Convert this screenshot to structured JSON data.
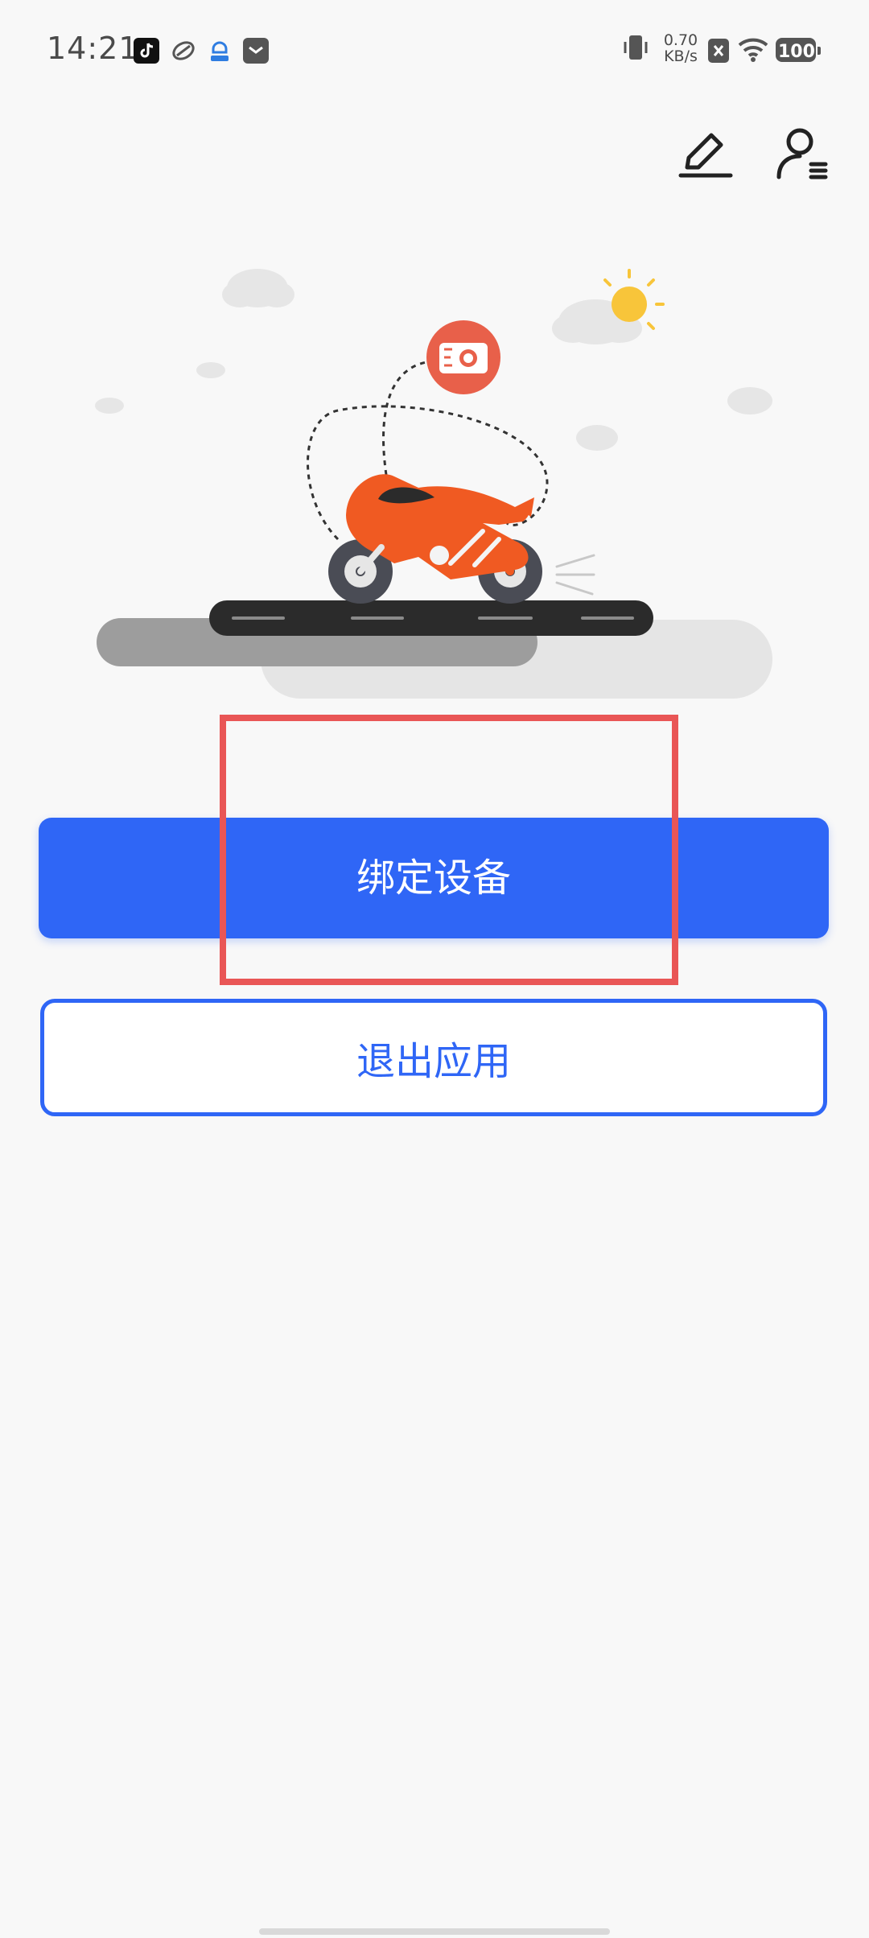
{
  "status_bar": {
    "time": "14:21",
    "net_speed_value": "0.70",
    "net_speed_unit": "KB/s",
    "battery": "100",
    "icons": [
      "tiktok-icon",
      "browser-icon",
      "vpn-shield-icon",
      "mail-icon",
      "vibrate-icon",
      "sim-off-icon",
      "wifi-icon"
    ]
  },
  "header": {
    "edit_icon": "pencil-icon",
    "profile_icon": "user-list-icon"
  },
  "illustration": {
    "subject": "motorcycle-with-camera",
    "colors": {
      "motorcycle": "#f05a22",
      "camera_badge": "#e8604a",
      "road": "#2b2b2b",
      "sun": "#f8c53a"
    }
  },
  "actions": {
    "bind_device_label": "绑定设备",
    "exit_app_label": "退出应用"
  },
  "colors": {
    "accent": "#2f66f6",
    "highlight": "#e95656",
    "background": "#f8f8f8"
  }
}
